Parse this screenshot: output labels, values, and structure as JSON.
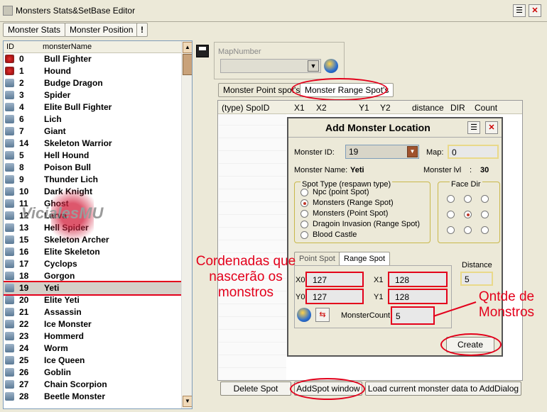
{
  "window": {
    "title": "Monsters Stats&SetBase Editor"
  },
  "tabs": {
    "stats": "Monster Stats",
    "position": "Monster Position",
    "alert": "!"
  },
  "list": {
    "col_id": "ID",
    "col_name": "monsterName",
    "rows": [
      {
        "id": "0",
        "name": "Bull Fighter"
      },
      {
        "id": "1",
        "name": "Hound"
      },
      {
        "id": "2",
        "name": "Budge Dragon"
      },
      {
        "id": "3",
        "name": "Spider"
      },
      {
        "id": "4",
        "name": "Elite Bull Fighter"
      },
      {
        "id": "6",
        "name": "Lich"
      },
      {
        "id": "7",
        "name": "Giant"
      },
      {
        "id": "14",
        "name": "Skeleton Warrior"
      },
      {
        "id": "5",
        "name": "Hell Hound"
      },
      {
        "id": "8",
        "name": "Poison Bull"
      },
      {
        "id": "9",
        "name": "Thunder Lich"
      },
      {
        "id": "10",
        "name": "Dark Knight"
      },
      {
        "id": "11",
        "name": "Ghost"
      },
      {
        "id": "12",
        "name": "Larva"
      },
      {
        "id": "13",
        "name": "Hell Spider"
      },
      {
        "id": "15",
        "name": "Skeleton Archer"
      },
      {
        "id": "16",
        "name": "Elite Skeleton"
      },
      {
        "id": "17",
        "name": "Cyclops"
      },
      {
        "id": "18",
        "name": "Gorgon"
      },
      {
        "id": "19",
        "name": "Yeti"
      },
      {
        "id": "20",
        "name": "Elite Yeti"
      },
      {
        "id": "21",
        "name": "Assassin"
      },
      {
        "id": "22",
        "name": "Ice Monster"
      },
      {
        "id": "23",
        "name": "Hommerd"
      },
      {
        "id": "24",
        "name": "Worm"
      },
      {
        "id": "25",
        "name": "Ice Queen"
      },
      {
        "id": "26",
        "name": "Goblin"
      },
      {
        "id": "27",
        "name": "Chain Scorpion"
      },
      {
        "id": "28",
        "name": "Beetle Monster"
      }
    ]
  },
  "watermark": "VicialesMU",
  "map": {
    "label": "MapNumber",
    "value": ""
  },
  "spot_tabs": {
    "point": "Monster Point spot's",
    "range": "Monster Range Spot's"
  },
  "grid_cols": [
    "(type) SpoID",
    "X1",
    "X2",
    "Y1",
    "Y2",
    "distance",
    "DIR",
    "Count"
  ],
  "dialog": {
    "title": "Add Monster Location",
    "monster_id_label": "Monster ID:",
    "monster_id_value": "19",
    "map_label": "Map:",
    "map_value": "0",
    "monster_name_label": "Monster Name:",
    "monster_name_value": "Yeti",
    "monster_lvl_label": "Monster lvl",
    "monster_lvl_sep": ":",
    "monster_lvl_value": "30",
    "spot_type_label": "Spot Type (respawn type)",
    "spot_types": [
      "Npc (point Spot)",
      "Monsters (Range Spot)",
      "Monsters (Point Spot)",
      "Dragoin Invasion (Range Spot)",
      "Blood Castle"
    ],
    "face_dir_label": "Face Dir",
    "sub_tabs": {
      "point": "Point Spot",
      "range": "Range Spot"
    },
    "distance_label": "Distance",
    "distance_value": "5",
    "x0_label": "X0",
    "x0_value": "127",
    "y0_label": "Y0",
    "y0_value": "127",
    "x1_label": "X1",
    "x1_value": "128",
    "y1_label": "Y1",
    "y1_value": "128",
    "count_label": "MonsterCount",
    "count_value": "5",
    "create_label": "Create"
  },
  "bottom_buttons": {
    "delete": "Delete Spot",
    "addspot": "AddSpot window",
    "load": "Load current monster data to AddDialog"
  },
  "annotations": {
    "coords_l1": "Cordenadas que",
    "coords_l2": "nascerão os",
    "coords_l3": "monstros",
    "qty_l1": "Qntde de",
    "qty_l2": "Monstros"
  },
  "colors": {
    "accent_red": "#e3001b",
    "window_bg": "#ece9d8"
  }
}
